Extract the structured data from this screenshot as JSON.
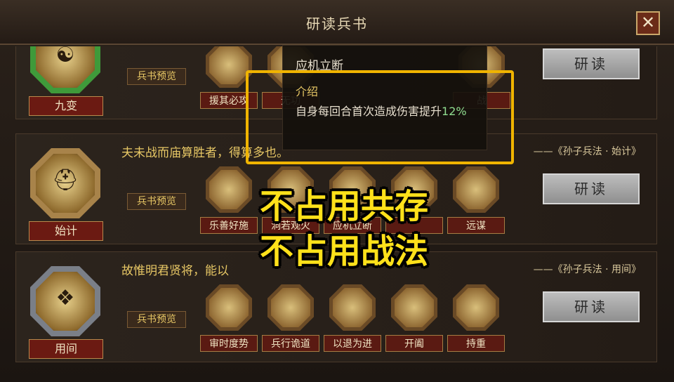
{
  "window": {
    "title": "研读兵书",
    "close_icon": "close-icon"
  },
  "rows": [
    {
      "name": "九变",
      "emblem_icon": "yin-yang-icon",
      "emblem_color": "#3f9a3a",
      "quote": "",
      "source": "",
      "preview_label": "兵书预览",
      "skills": [
        "援其必攻",
        "无功",
        "",
        "",
        "战"
      ],
      "read_label": "研读"
    },
    {
      "name": "始计",
      "emblem_icon": "helmet-icon",
      "emblem_color": "#a8834a",
      "quote": "夫未战而庙算胜者，得算多也。",
      "source": "——《孙子兵法 · 始计》",
      "preview_label": "兵书预览",
      "skills": [
        "乐善好施",
        "洞若观火",
        "应机立断",
        "",
        "远谋"
      ],
      "read_label": "研读"
    },
    {
      "name": "用间",
      "emblem_icon": "cloak-icon",
      "emblem_color": "#7a7f88",
      "quote": "故惟明君贤将，能以",
      "source": "——《孙子兵法 · 用间》",
      "preview_label": "兵书预览",
      "skills": [
        "审时度势",
        "兵行诡道",
        "以退为进",
        "开阖",
        "持重"
      ],
      "read_label": "研读"
    }
  ],
  "tooltip": {
    "title": "应机立断",
    "section": "介绍",
    "desc": "自身每回合首次造成伤害提升",
    "value": "12%"
  },
  "overlay": {
    "line1": "不占用共存",
    "line2": "不占用战法"
  }
}
